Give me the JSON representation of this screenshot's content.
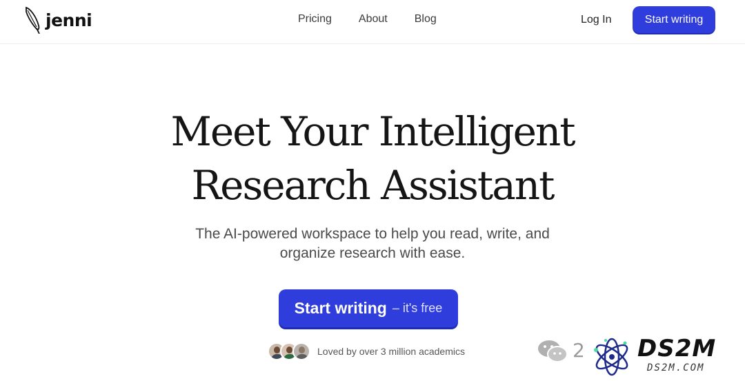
{
  "header": {
    "logo_text": "jenni",
    "nav": [
      {
        "label": "Pricing"
      },
      {
        "label": "About"
      },
      {
        "label": "Blog"
      }
    ],
    "login_label": "Log In",
    "cta_label": "Start writing"
  },
  "hero": {
    "title_line1": "Meet Your Intelligent",
    "title_line2": "Research Assistant",
    "subtitle_line1": "The AI-powered workspace to help you read, write, and",
    "subtitle_line2": "organize research with ease.",
    "cta_main": "Start writing",
    "cta_sub": "– it's free",
    "social_proof": "Loved by over 3 million academics"
  },
  "watermark": {
    "partial_digit": "2",
    "brand": "DS2M",
    "sub": "DS2M.COM"
  },
  "colors": {
    "brand_blue": "#2e3ddb",
    "text_dark": "#151515",
    "text_muted": "#4a4a4a"
  },
  "icons": [
    "feather-logo-icon",
    "avatar-group",
    "wechat-icon",
    "atom-icon"
  ]
}
